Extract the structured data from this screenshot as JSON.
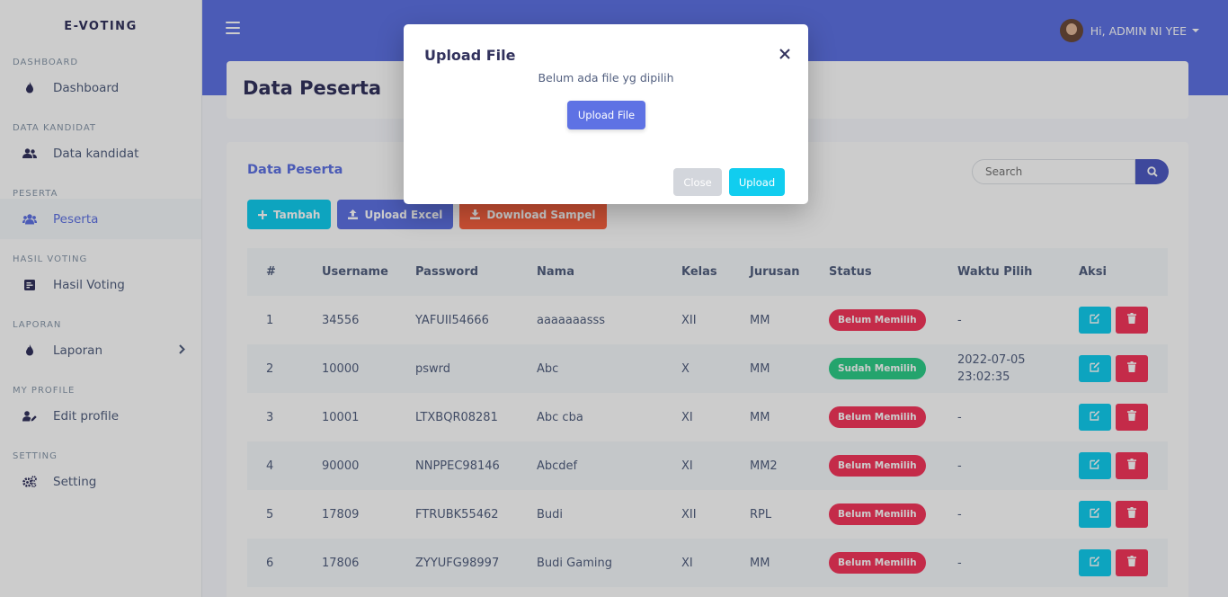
{
  "brand": "E-VOTING",
  "sidebar": {
    "sections": [
      {
        "heading": "DASHBOARD",
        "label": "Dashboard"
      },
      {
        "heading": "DATA KANDIDAT",
        "label": "Data kandidat"
      },
      {
        "heading": "PESERTA",
        "label": "Peserta"
      },
      {
        "heading": "HASIL VOTING",
        "label": "Hasil Voting"
      },
      {
        "heading": "LAPORAN",
        "label": "Laporan"
      },
      {
        "heading": "MY PROFILE",
        "label": "Edit profile"
      },
      {
        "heading": "SETTING",
        "label": "Setting"
      }
    ]
  },
  "header": {
    "user_greeting": "Hi, ADMIN NI YEE"
  },
  "page": {
    "title": "Data Peserta",
    "card_title": "Data Peserta",
    "search_placeholder": "Search",
    "buttons": {
      "add": "Tambah",
      "upload_excel": "Upload Excel",
      "download_sample": "Download Sampel"
    }
  },
  "table": {
    "headers": [
      "#",
      "Username",
      "Password",
      "Nama",
      "Kelas",
      "Jurusan",
      "Status",
      "Waktu Pilih",
      "Aksi"
    ],
    "rows": [
      {
        "no": "1",
        "username": "34556",
        "password": "YAFUII54666",
        "nama": "aaaaaaasss",
        "kelas": "XII",
        "jurusan": "MM",
        "status": "Belum Memilih",
        "waktu": "-"
      },
      {
        "no": "2",
        "username": "10000",
        "password": "pswrd",
        "nama": "Abc",
        "kelas": "X",
        "jurusan": "MM",
        "status": "Sudah Memilih",
        "waktu": "2022-07-05 23:02:35"
      },
      {
        "no": "3",
        "username": "10001",
        "password": "LTXBQR08281",
        "nama": "Abc cba",
        "kelas": "XI",
        "jurusan": "MM",
        "status": "Belum Memilih",
        "waktu": "-"
      },
      {
        "no": "4",
        "username": "90000",
        "password": "NNPPEC98146",
        "nama": "Abcdef",
        "kelas": "XI",
        "jurusan": "MM2",
        "status": "Belum Memilih",
        "waktu": "-"
      },
      {
        "no": "5",
        "username": "17809",
        "password": "FTRUBK55462",
        "nama": "Budi",
        "kelas": "XII",
        "jurusan": "RPL",
        "status": "Belum Memilih",
        "waktu": "-"
      },
      {
        "no": "6",
        "username": "17806",
        "password": "ZYYUFG98997",
        "nama": "Budi Gaming",
        "kelas": "XI",
        "jurusan": "MM",
        "status": "Belum Memilih",
        "waktu": "-"
      }
    ]
  },
  "modal": {
    "title": "Upload File",
    "status_text": "Belum ada file yg dipilih",
    "select_button": "Upload File",
    "close_button": "Close",
    "upload_button": "Upload"
  },
  "icons": {
    "menu": "hamburger-icon",
    "dashboard": "flame-icon",
    "kandidat": "users-icon",
    "peserta": "users-icon",
    "hasil": "poll-icon",
    "laporan": "flame-icon",
    "profile": "user-edit-icon",
    "setting": "cogs-icon"
  },
  "colors": {
    "primary": "#5e72e4",
    "info": "#11cdef",
    "danger": "#f5365c",
    "success": "#2dce89",
    "warning": "#fb6340"
  }
}
